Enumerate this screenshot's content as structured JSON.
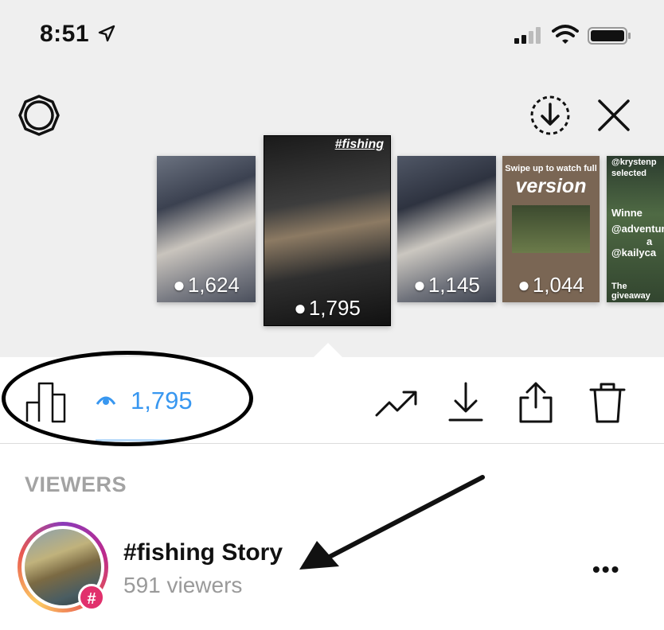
{
  "status_bar": {
    "time": "8:51"
  },
  "thumbnails": [
    {
      "views": "1,624",
      "caption": "",
      "tag": ""
    },
    {
      "views": "1,795",
      "caption": "",
      "tag": "#fishing"
    },
    {
      "views": "1,145",
      "caption": "",
      "tag": ""
    },
    {
      "views": "1,044",
      "caption_small": "Swipe up to watch full",
      "caption_big": "version"
    },
    {
      "views": "",
      "lines": [
        "@krystenp",
        "selected",
        "Winne",
        "@adventur",
        "a",
        "@kailyca",
        "The",
        "giveaway"
      ]
    }
  ],
  "toolbar": {
    "view_count": "1,795"
  },
  "viewers": {
    "header": "VIEWERS",
    "story_title": "#fishing Story",
    "story_subtitle": "591 viewers",
    "badge": "#"
  },
  "colors": {
    "accent": "#3897f0",
    "badge": "#e1306c",
    "header_gray": "#a3a3a3"
  }
}
